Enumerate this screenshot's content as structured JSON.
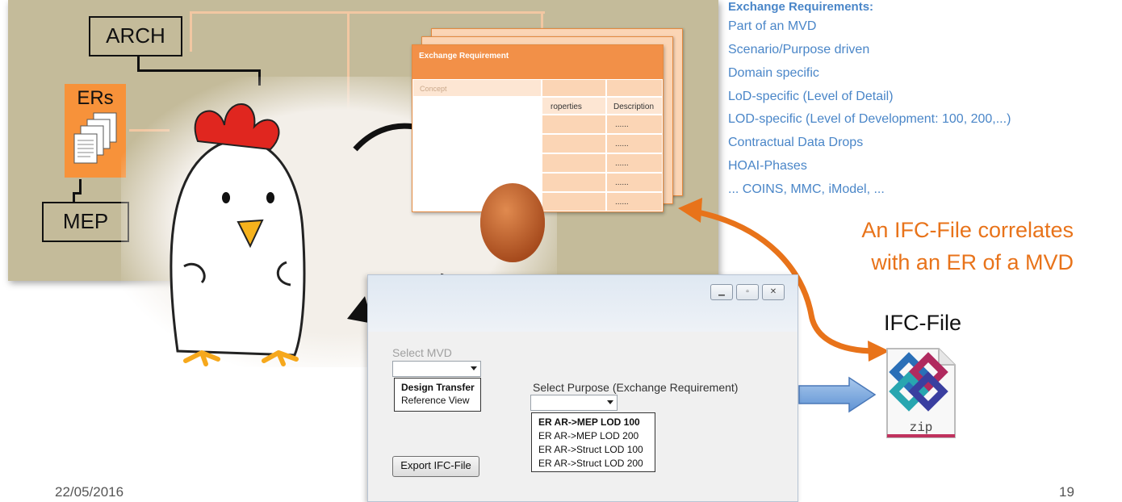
{
  "left_diagram": {
    "arch_label": "ARCH",
    "ers_label": "ERs",
    "mep_label": "MEP"
  },
  "er_table": {
    "header": "Exchange Requirement",
    "concept_label": "Concept",
    "col_properties": "roperties",
    "col_description": "Description",
    "cell_placeholder": "......"
  },
  "requirements": {
    "title": "Exchange Requirements:",
    "items": [
      "Part of an MVD",
      "Scenario/Purpose driven",
      "Domain specific",
      "LoD-specific (Level of Detail)",
      "LOD-specific (Level of Development: 100, 200,...)",
      "Contractual Data Drops",
      "HOAI-Phases",
      "... COINS, MMC, iModel, ..."
    ]
  },
  "correlation": {
    "line1": "An IFC-File correlates",
    "line2": "with an ER of a MVD"
  },
  "ifc_file": {
    "label": "IFC-File",
    "zip_text": "zip"
  },
  "dialog": {
    "select_mvd_label": "Select MVD",
    "mvd_options": [
      "Design Transfer",
      "Reference View"
    ],
    "select_purpose_label": "Select Purpose (Exchange Requirement)",
    "purpose_options": [
      "ER AR->MEP LOD 100",
      "ER AR->MEP LOD 200",
      "ER AR->Struct LOD 100",
      "ER AR->Struct LOD 200"
    ],
    "export_button": "Export IFC-File"
  },
  "footer": {
    "date": "22/05/2016",
    "page": "19"
  },
  "colors": {
    "tan": "#c4bb9a",
    "orange": "#f7923a",
    "blue_text": "#4a86c8",
    "orange_text": "#e8731a"
  }
}
